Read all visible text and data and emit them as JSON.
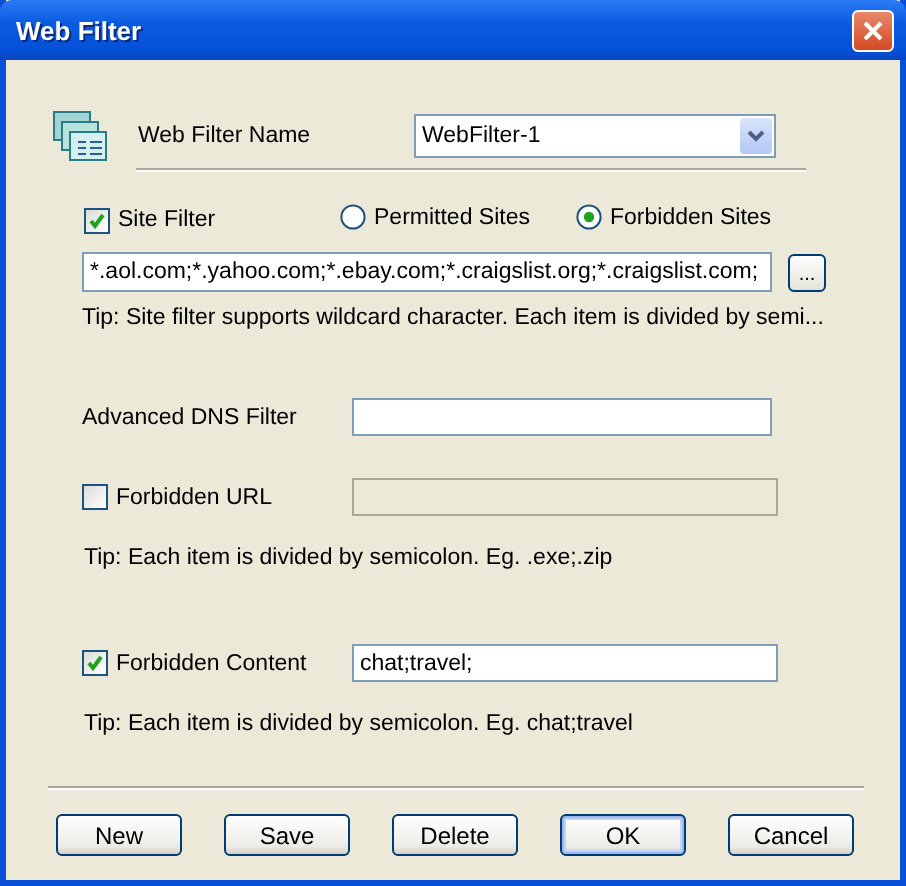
{
  "window": {
    "title": "Web Filter"
  },
  "name_field": {
    "label": "Web Filter Name",
    "value": "WebFilter-1"
  },
  "site_filter": {
    "label": "Site Filter",
    "checked": true,
    "modes": [
      {
        "label": "Permitted Sites",
        "selected": false
      },
      {
        "label": "Forbidden Sites",
        "selected": true
      }
    ],
    "value": "*.aol.com;*.yahoo.com;*.ebay.com;*.craigslist.org;*.craigslist.com;",
    "browse_label": "...",
    "tip": "Tip: Site filter supports wildcard character. Each item is divided by semi..."
  },
  "dns_filter": {
    "label": "Advanced DNS Filter"
  },
  "forbidden_url": {
    "label": "Forbidden URL",
    "checked": false,
    "tip": "Tip: Each item is divided by semicolon. Eg. .exe;.zip"
  },
  "forbidden_content": {
    "label": "Forbidden Content",
    "checked": true,
    "value": "chat;travel;",
    "tip": "Tip: Each item is divided by semicolon. Eg. chat;travel"
  },
  "buttons": [
    {
      "label": "New",
      "default": false
    },
    {
      "label": "Save",
      "default": false
    },
    {
      "label": "Delete",
      "default": false
    },
    {
      "label": "OK",
      "default": true
    },
    {
      "label": "Cancel",
      "default": false
    }
  ]
}
